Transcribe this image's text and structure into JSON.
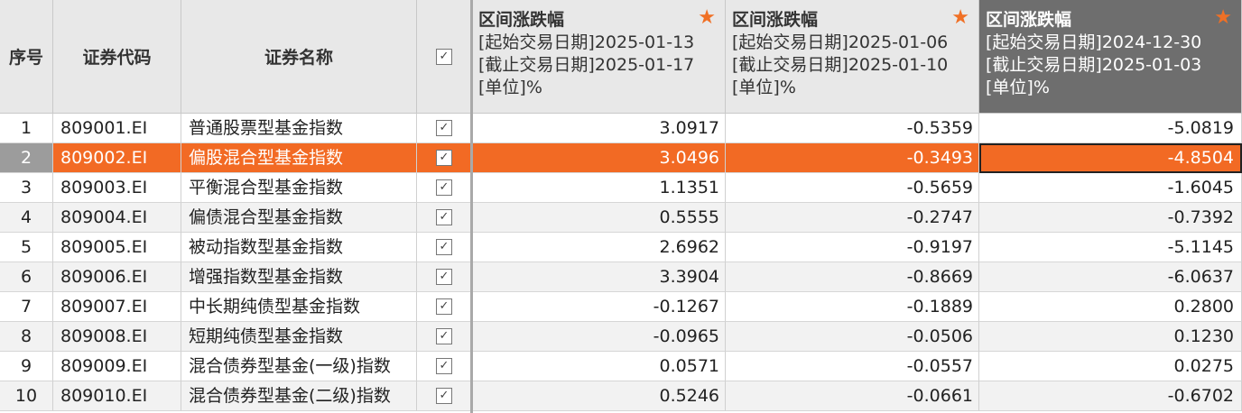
{
  "header": {
    "seq": "序号",
    "code": "证券代码",
    "name": "证券名称",
    "checkbox_mark": "✓",
    "metric_cols": [
      {
        "title": "区间涨跌幅",
        "start": "[起始交易日期]2025-01-13",
        "end": "[截止交易日期]2025-01-17",
        "unit": "[单位]%",
        "star": "★"
      },
      {
        "title": "区间涨跌幅",
        "start": "[起始交易日期]2025-01-06",
        "end": "[截止交易日期]2025-01-10",
        "unit": "[单位]%",
        "star": "★"
      },
      {
        "title": "区间涨跌幅",
        "start": "[起始交易日期]2024-12-30",
        "end": "[截止交易日期]2025-01-03",
        "unit": "[单位]%",
        "star": "★"
      }
    ]
  },
  "rows": [
    {
      "seq": "1",
      "code": "809001.EI",
      "name": "普通股票型基金指数",
      "check": "✓",
      "v1": "3.0917",
      "v2": "-0.5359",
      "v3": "-5.0819"
    },
    {
      "seq": "2",
      "code": "809002.EI",
      "name": "偏股混合型基金指数",
      "check": "✓",
      "v1": "3.0496",
      "v2": "-0.3493",
      "v3": "-4.8504"
    },
    {
      "seq": "3",
      "code": "809003.EI",
      "name": "平衡混合型基金指数",
      "check": "✓",
      "v1": "1.1351",
      "v2": "-0.5659",
      "v3": "-1.6045"
    },
    {
      "seq": "4",
      "code": "809004.EI",
      "name": "偏债混合型基金指数",
      "check": "✓",
      "v1": "0.5555",
      "v2": "-0.2747",
      "v3": "-0.7392"
    },
    {
      "seq": "5",
      "code": "809005.EI",
      "name": "被动指数型基金指数",
      "check": "✓",
      "v1": "2.6962",
      "v2": "-0.9197",
      "v3": "-5.1145"
    },
    {
      "seq": "6",
      "code": "809006.EI",
      "name": "增强指数型基金指数",
      "check": "✓",
      "v1": "3.3904",
      "v2": "-0.8669",
      "v3": "-6.0637"
    },
    {
      "seq": "7",
      "code": "809007.EI",
      "name": "中长期纯债型基金指数",
      "check": "✓",
      "v1": "-0.1267",
      "v2": "-0.1889",
      "v3": "0.2800"
    },
    {
      "seq": "8",
      "code": "809008.EI",
      "name": "短期纯债型基金指数",
      "check": "✓",
      "v1": "-0.0965",
      "v2": "-0.0506",
      "v3": "0.1230"
    },
    {
      "seq": "9",
      "code": "809009.EI",
      "name": "混合债券型基金(一级)指数",
      "check": "✓",
      "v1": "0.0571",
      "v2": "-0.0557",
      "v3": "0.0275"
    },
    {
      "seq": "10",
      "code": "809010.EI",
      "name": "混合债券型基金(二级)指数",
      "check": "✓",
      "v1": "0.5246",
      "v2": "-0.0661",
      "v3": "-0.6702"
    }
  ],
  "selected_row": 2,
  "colors": {
    "selected_row": "#f26a24",
    "star": "#f07025",
    "active_header": "#6e6e6e"
  }
}
